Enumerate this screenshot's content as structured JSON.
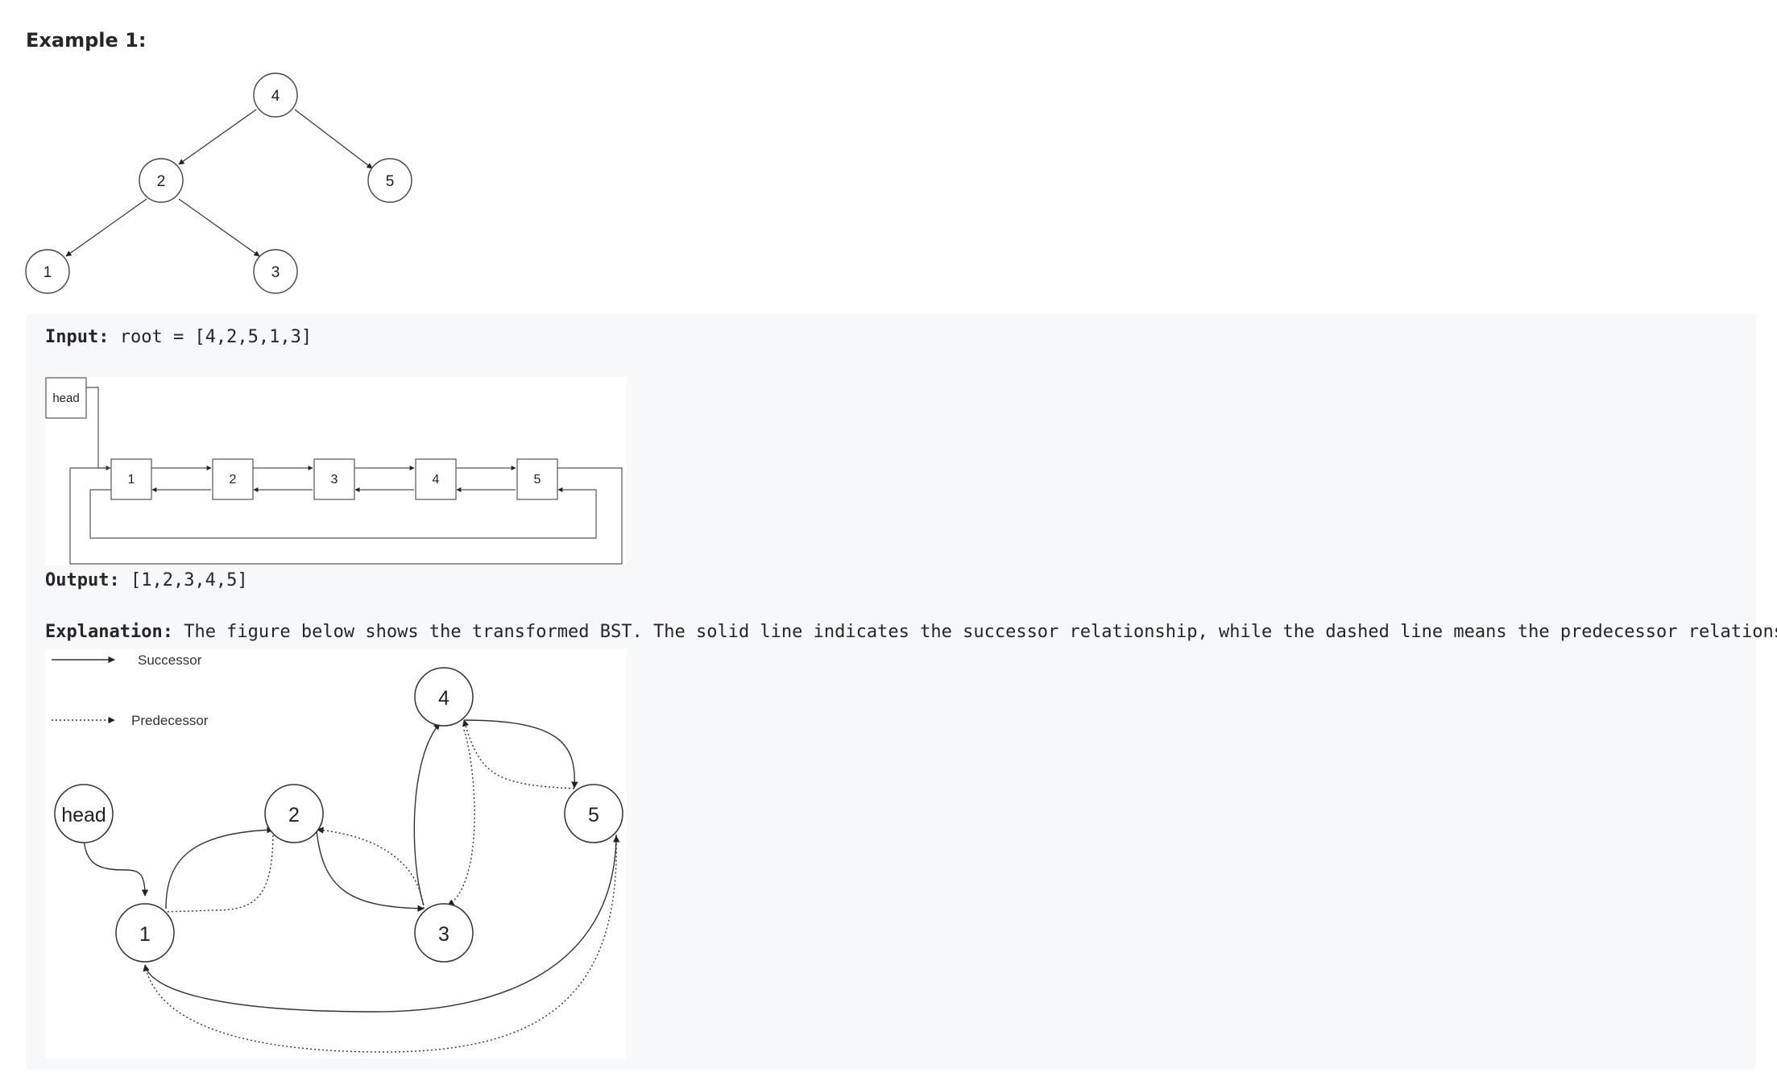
{
  "example": {
    "title": "Example 1:"
  },
  "tree": {
    "nodes": [
      "4",
      "2",
      "5",
      "1",
      "3"
    ]
  },
  "input": {
    "label": "Input:",
    "value": " root = [4,2,5,1,3]"
  },
  "list_figure": {
    "head_label": "head",
    "nodes": [
      "1",
      "2",
      "3",
      "4",
      "5"
    ]
  },
  "output": {
    "label": "Output:",
    "value": " [1,2,3,4,5]"
  },
  "explanation": {
    "label": "Explanation:",
    "text": " The figure below shows the transformed BST. The solid line indicates the successor relationship, while the dashed line means the predecessor relationship."
  },
  "graph_figure": {
    "legend_successor": "Successor",
    "legend_predecessor": "Predecessor",
    "head_label": "head",
    "nodes": [
      "1",
      "2",
      "3",
      "4",
      "5"
    ]
  }
}
